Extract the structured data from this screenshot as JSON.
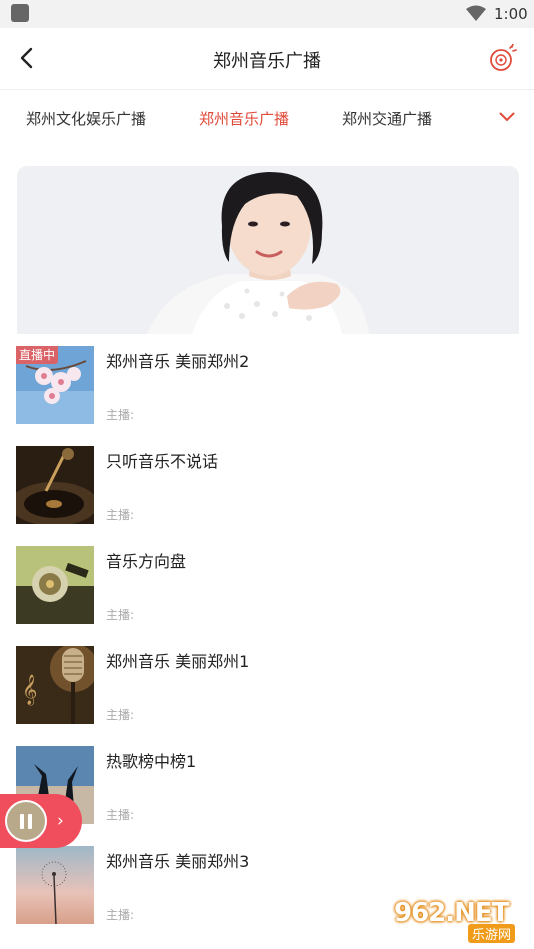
{
  "status_bar": {
    "time": "1:00"
  },
  "header": {
    "title": "郑州音乐广播"
  },
  "channel_tabs": {
    "tabs": [
      {
        "label": "郑州文化娱乐广播",
        "active": false
      },
      {
        "label": "郑州音乐广播",
        "active": true
      },
      {
        "label": "郑州交通广播",
        "active": false
      }
    ],
    "active_color": "#e04a3a"
  },
  "programs": [
    {
      "title": "郑州音乐 美丽郑州2",
      "host_label": "主播:",
      "badge": "直播中"
    },
    {
      "title": "只听音乐不说话",
      "host_label": "主播:"
    },
    {
      "title": "音乐方向盘",
      "host_label": "主播:"
    },
    {
      "title": "郑州音乐 美丽郑州1",
      "host_label": "主播:"
    },
    {
      "title": "热歌榜中榜1",
      "host_label": "主播:"
    },
    {
      "title": "郑州音乐 美丽郑州3",
      "host_label": "主播:"
    }
  ],
  "mini_player": {
    "state": "playing",
    "accent_color": "#f04e5c"
  },
  "watermark": {
    "main": "962.NET",
    "sub": "乐游网"
  }
}
